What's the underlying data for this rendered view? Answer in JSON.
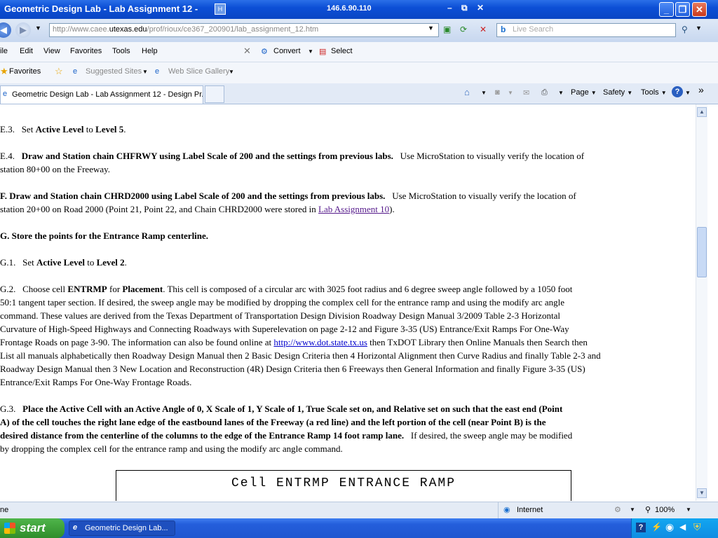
{
  "window": {
    "title": "Geometric Design Lab - Lab Assignment 12 - ",
    "remote_ip": "146.6.90.110",
    "minimize": "_",
    "restore": "❐",
    "close": "✕"
  },
  "address": {
    "url_prefix": "http://www.caee.",
    "url_domain": "utexas.edu",
    "url_path": "/prof/rioux/ce367_200901/lab_assignment_12.htm",
    "search_placeholder": "Live Search"
  },
  "menu": {
    "items": [
      "ile",
      "Edit",
      "View",
      "Favorites",
      "Tools",
      "Help"
    ],
    "convert": "Convert",
    "select": "Select"
  },
  "favorites_bar": {
    "favorites": "Favorites",
    "suggested": "Suggested Sites",
    "webslice": "Web Slice Gallery"
  },
  "tabs": {
    "active_tab": "Geometric Design Lab - Lab Assignment 12 - Design Pr...",
    "page": "Page",
    "safety": "Safety",
    "tools": "Tools",
    "more": "»"
  },
  "content": {
    "e3_num": "E.3.",
    "e3_a": "Set ",
    "e3_b": "Active Level",
    "e3_c": " to ",
    "e3_d": "Level 5",
    "e3_e": ".",
    "e4_num": "E.4.",
    "e4_bold": "Draw and Station chain CHFRWY using Label Scale of 200 and the settings from previous labs.",
    "e4_rest1": "Use MicroStation to visually verify the location of",
    "e4_rest2": "station 80+00 on the Freeway.",
    "f_bold": "F.   Draw and Station chain CHRD2000 using Label Scale of 200 and the settings from previous labs.",
    "f_rest1": "Use MicroStation to visually verify the location of",
    "f_rest2": "station 20+00 on Road 2000 (Point 21, Point 22, and Chain CHRD2000 were stored in ",
    "f_link": "Lab Assignment 10",
    "f_end": ").",
    "g": "G.   Store the points for the Entrance Ramp centerline.",
    "g1_num": "G.1.",
    "g1_a": "Set ",
    "g1_b": "Active Level",
    "g1_c": " to ",
    "g1_d": "Level 2",
    "g1_e": ".",
    "g2_num": "G.2.",
    "g2_a": "Choose cell ",
    "g2_b": "ENTRMP",
    "g2_c": " for ",
    "g2_d": "Placement",
    "g2_l1": ".   This cell is composed of a circular arc with 3025 foot radius and 6 degree sweep angle followed by a 1050 foot",
    "g2_l2": "50:1 tangent taper section.   If desired, the sweep angle may be modified by dropping the complex cell for the entrance ramp and using the modify arc angle",
    "g2_l3": "command.   These values are derived from the Texas Department of Transportation Design Division Roadway Design Manual 3/2009 Table 2-3 Horizontal",
    "g2_l4": "Curvature of High-Speed Highways and Connecting Roadways with Superelevation on page 2-12 and Figure 3-35 (US) Entrance/Exit Ramps For One-Way",
    "g2_l5a": "Frontage Roads on page 3-90.   The information can also be found online at ",
    "g2_link": "http://www.dot.state.tx.us",
    "g2_l5b": " then TxDOT Library then Online Manuals then Search then",
    "g2_l6": "List all manuals alphabetically then Roadway Design Manual then 2 Basic Design Criteria then 4 Horizontal Alignment then Curve Radius and finally Table 2-3 and",
    "g2_l7": "Roadway Design Manual then 3 New Location and Reconstruction (4R) Design Criteria then 6 Freeways then General Information and finally Figure 3-35 (US)",
    "g2_l8": "Entrance/Exit Ramps For One-Way Frontage Roads.",
    "g3_num": "G.3.",
    "g3_l1": "Place the Active Cell with an Active Angle of 0, X Scale of 1, Y Scale of 1, True Scale set on, and Relative set on such that the east end (Point",
    "g3_l2": "A) of the cell touches the right lane edge of the eastbound lanes of the Freeway (a red line) and the left portion of the cell (near Point B) is the",
    "g3_l3": "desired distance from the centerline of the columns to the edge of the Entrance Ramp 14 foot ramp lane.",
    "g3_l3b": "If desired, the sweep angle may be modified",
    "g3_l4": "by dropping the complex cell for the entrance ramp and using the modify arc angle command.",
    "cell_title": "Cell   ENTRMP   ENTRANCE  RAMP"
  },
  "status": {
    "left": "ne",
    "zone": "Internet",
    "zoom": "100%"
  },
  "taskbar": {
    "start": "start",
    "item": "Geometric Design Lab..."
  }
}
